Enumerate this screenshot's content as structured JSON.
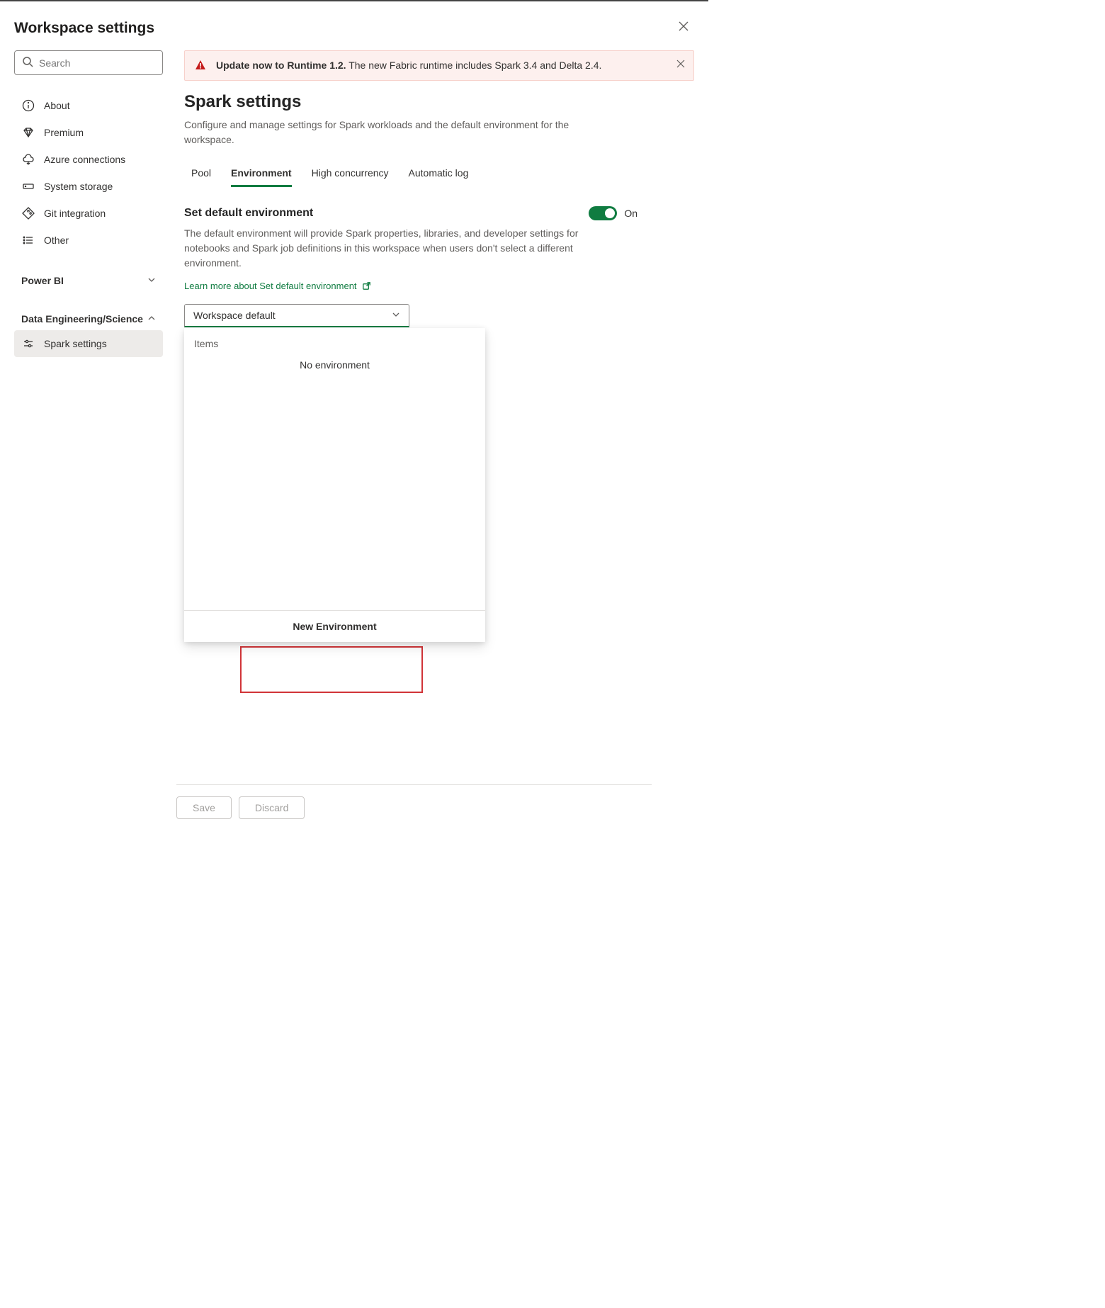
{
  "header": {
    "title": "Workspace settings"
  },
  "search": {
    "placeholder": "Search"
  },
  "sidebar": {
    "items": [
      {
        "label": "About"
      },
      {
        "label": "Premium"
      },
      {
        "label": "Azure connections"
      },
      {
        "label": "System storage"
      },
      {
        "label": "Git integration"
      },
      {
        "label": "Other"
      }
    ],
    "sections": {
      "powerbi": {
        "label": "Power BI"
      },
      "data": {
        "label": "Data Engineering/Science",
        "items": [
          {
            "label": "Spark settings"
          }
        ]
      }
    }
  },
  "alert": {
    "bold": "Update now to Runtime 1.2.",
    "text": "The new Fabric runtime includes Spark 3.4 and Delta 2.4."
  },
  "spark": {
    "title": "Spark settings",
    "desc": "Configure and manage settings for Spark workloads and the default environment for the workspace."
  },
  "tabs": [
    {
      "label": "Pool"
    },
    {
      "label": "Environment"
    },
    {
      "label": "High concurrency"
    },
    {
      "label": "Automatic log"
    }
  ],
  "default_env": {
    "title": "Set default environment",
    "toggle_state": "On",
    "desc": "The default environment will provide Spark properties, libraries, and developer settings for notebooks and Spark job definitions in this workspace when users don't select a different environment.",
    "learn_more": "Learn more about Set default environment",
    "dropdown_value": "Workspace default",
    "dropdown": {
      "section_label": "Items",
      "empty_text": "No environment",
      "footer_action": "New Environment"
    }
  },
  "footer": {
    "save": "Save",
    "discard": "Discard"
  }
}
